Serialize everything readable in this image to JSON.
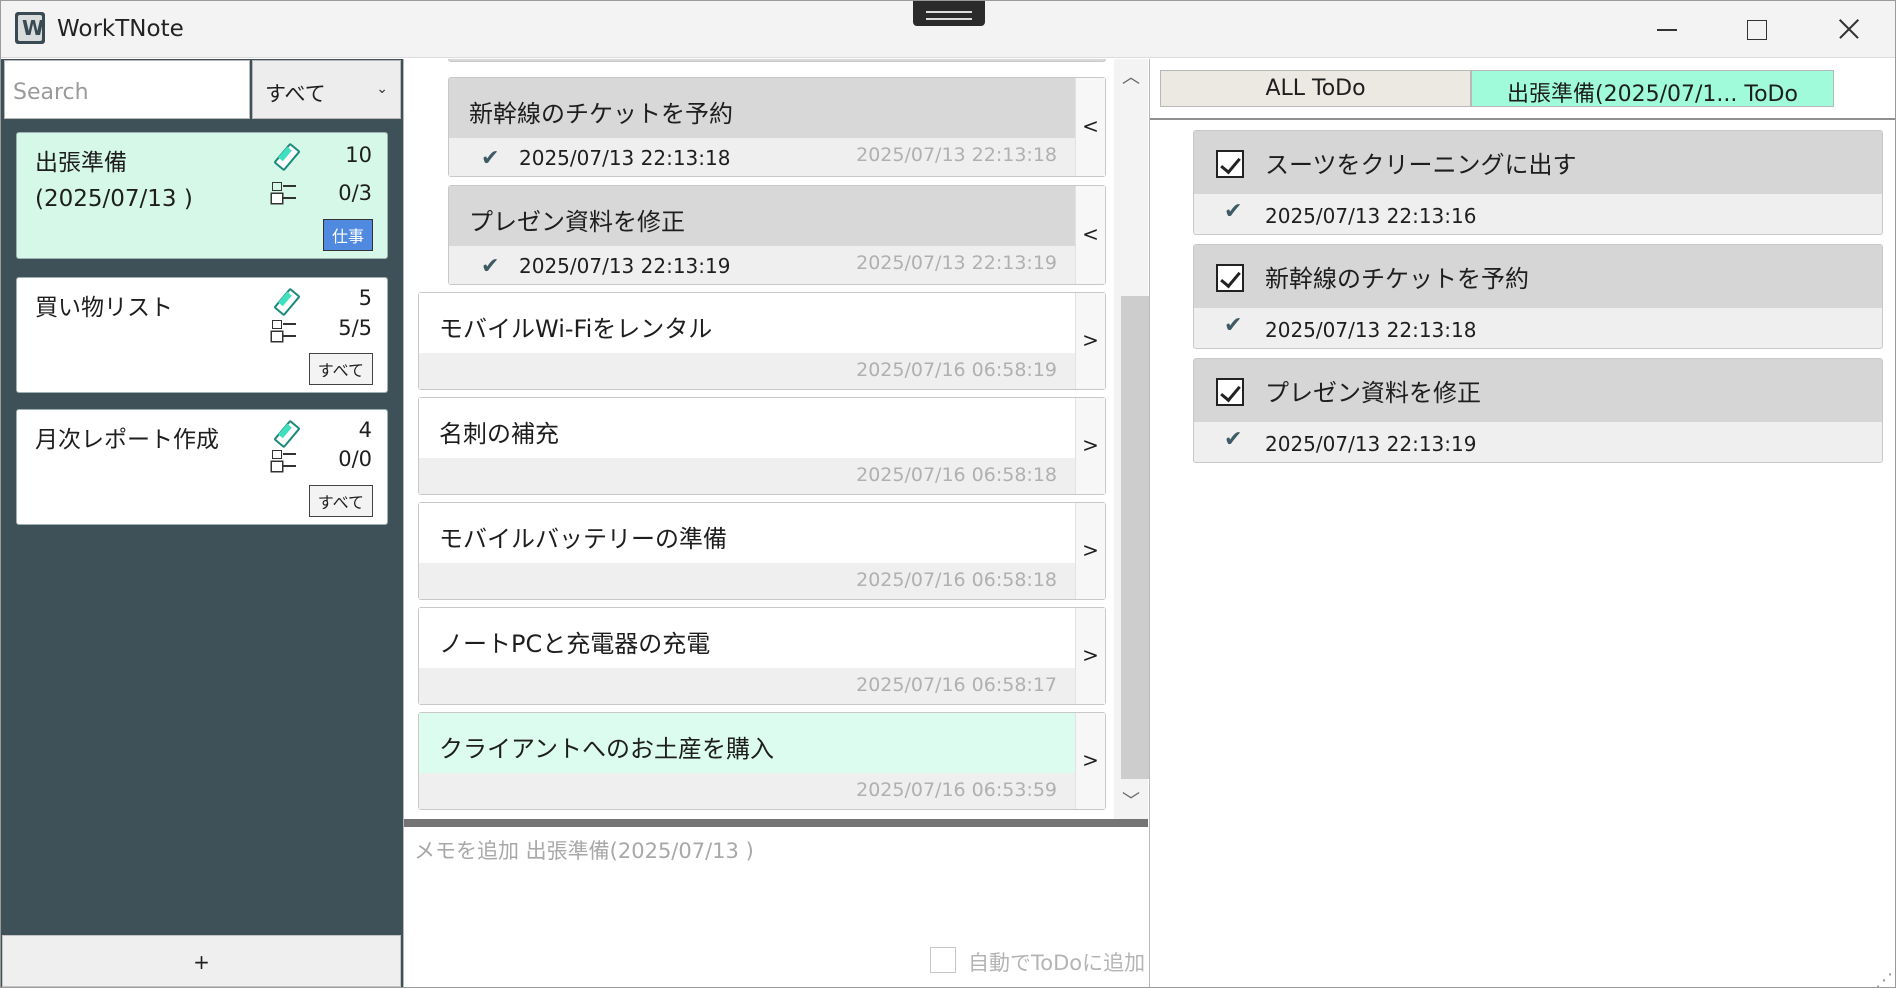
{
  "window": {
    "title": "WorkTNote",
    "controls": {
      "minimize": "minimize",
      "maximize": "maximize",
      "close": "close"
    }
  },
  "sidebar": {
    "search_placeholder": "Search",
    "filter": {
      "selected": "すべて"
    },
    "notes": [
      {
        "title_line1": "出張準備",
        "title_line2": "(2025/07/13 )",
        "memo_count": "10",
        "todo_count": "0/3",
        "tag": "仕事",
        "active": true
      },
      {
        "title_line1": "買い物リスト",
        "title_line2": "",
        "memo_count": "5",
        "todo_count": "5/5",
        "tag": "すべて",
        "active": false
      },
      {
        "title_line1": "月次レポート作成",
        "title_line2": "",
        "memo_count": "4",
        "todo_count": "0/0",
        "tag": "すべて",
        "active": false
      }
    ],
    "add_label": "+"
  },
  "memos": {
    "items": [
      {
        "title": "新幹線のチケットを予約",
        "done_date": "2025/07/13 22:13:18",
        "date": "2025/07/13 22:13:18",
        "arrow": "<",
        "child": true
      },
      {
        "title": "プレゼン資料を修正",
        "done_date": "2025/07/13 22:13:19",
        "date": "2025/07/13 22:13:19",
        "arrow": "<",
        "child": true
      },
      {
        "title": "モバイルWi-Fiをレンタル",
        "done_date": "",
        "date": "2025/07/16 06:58:19",
        "arrow": ">",
        "child": false
      },
      {
        "title": "名刺の補充",
        "done_date": "",
        "date": "2025/07/16 06:58:18",
        "arrow": ">",
        "child": false
      },
      {
        "title": "モバイルバッテリーの準備",
        "done_date": "",
        "date": "2025/07/16 06:58:18",
        "arrow": ">",
        "child": false
      },
      {
        "title": "ノートPCと充電器の充電",
        "done_date": "",
        "date": "2025/07/16 06:58:17",
        "arrow": ">",
        "child": false
      },
      {
        "title": "クライアントへのお土産を購入",
        "done_date": "",
        "date": "2025/07/16 06:53:59",
        "arrow": ">",
        "child": false,
        "highlight": true
      }
    ],
    "input_placeholder": "メモを追加 出張準備(2025/07/13 )",
    "auto_todo_label": "自動でToDoに追加"
  },
  "todo_panel": {
    "tabs": [
      {
        "label": "ALL ToDo"
      },
      {
        "label": "出張準備(2025/07/1... ToDo"
      }
    ],
    "items": [
      {
        "title": "スーツをクリーニングに出す",
        "date": "2025/07/13 22:13:16",
        "checked": true
      },
      {
        "title": "新幹線のチケットを予約",
        "date": "2025/07/13 22:13:18",
        "checked": true
      },
      {
        "title": "プレゼン資料を修正",
        "date": "2025/07/13 22:13:19",
        "checked": true
      }
    ]
  },
  "colors": {
    "sidebar_bg": "#3e5058",
    "active_card": "#d6f8e9",
    "work_tag": "#4f89e0",
    "active_tab": "#9ffbda",
    "highlight_memo": "#dcfcef"
  }
}
